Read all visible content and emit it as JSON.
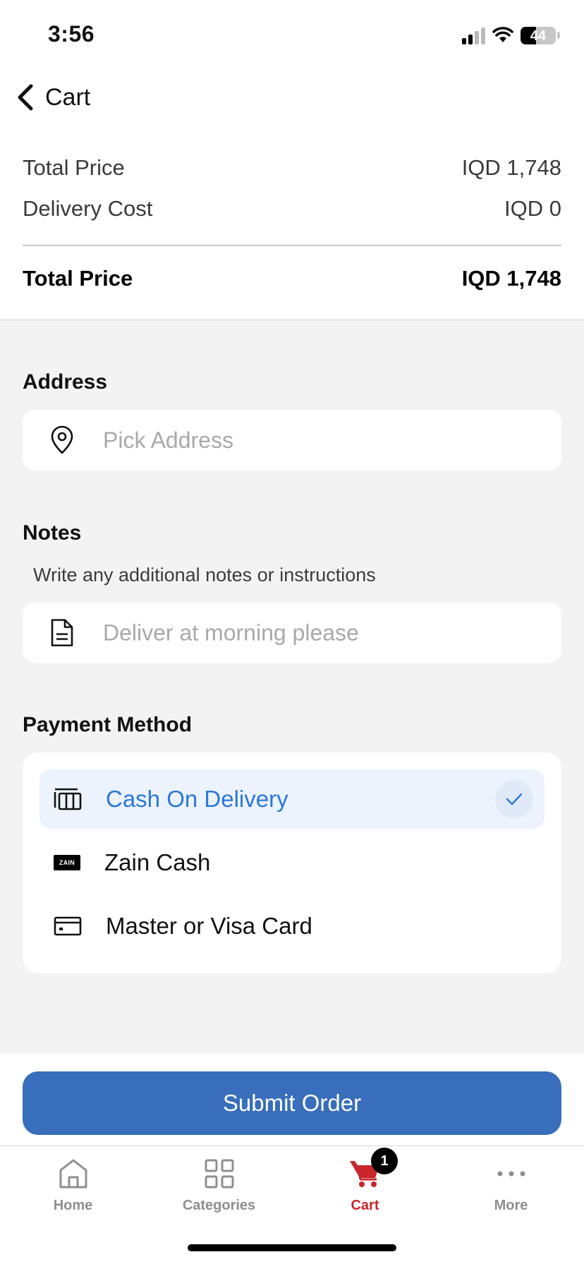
{
  "status_bar": {
    "time": "3:56",
    "battery": "44"
  },
  "header": {
    "back_label": "Cart"
  },
  "summary": {
    "rows": [
      {
        "label": "Total Price",
        "value": "IQD 1,748"
      },
      {
        "label": "Delivery Cost",
        "value": "IQD 0"
      }
    ],
    "total": {
      "label": "Total Price",
      "value": "IQD 1,748"
    }
  },
  "address": {
    "title": "Address",
    "placeholder": "Pick Address"
  },
  "notes": {
    "title": "Notes",
    "hint": "Write any additional notes or instructions",
    "placeholder": "Deliver at morning please"
  },
  "payment": {
    "title": "Payment Method",
    "options": [
      {
        "label": "Cash On Delivery",
        "selected": true,
        "icon": "cash-icon"
      },
      {
        "label": "Zain Cash",
        "selected": false,
        "icon": "zain-cash-logo",
        "logo_text": "ZAIN CASH"
      },
      {
        "label": "Master or Visa Card",
        "selected": false,
        "icon": "credit-card-icon"
      }
    ]
  },
  "submit_label": "Submit Order",
  "tabs": [
    {
      "label": "Home",
      "icon": "home-icon",
      "active": false
    },
    {
      "label": "Categories",
      "icon": "grid-icon",
      "active": false
    },
    {
      "label": "Cart",
      "icon": "cart-icon",
      "active": true,
      "badge": "1"
    },
    {
      "label": "More",
      "icon": "more-icon",
      "active": false
    }
  ],
  "colors": {
    "primary": "#386ebb",
    "accent_red": "#c8262b",
    "selected_bg": "#edf3fc",
    "selected_text": "#2a78d8"
  }
}
